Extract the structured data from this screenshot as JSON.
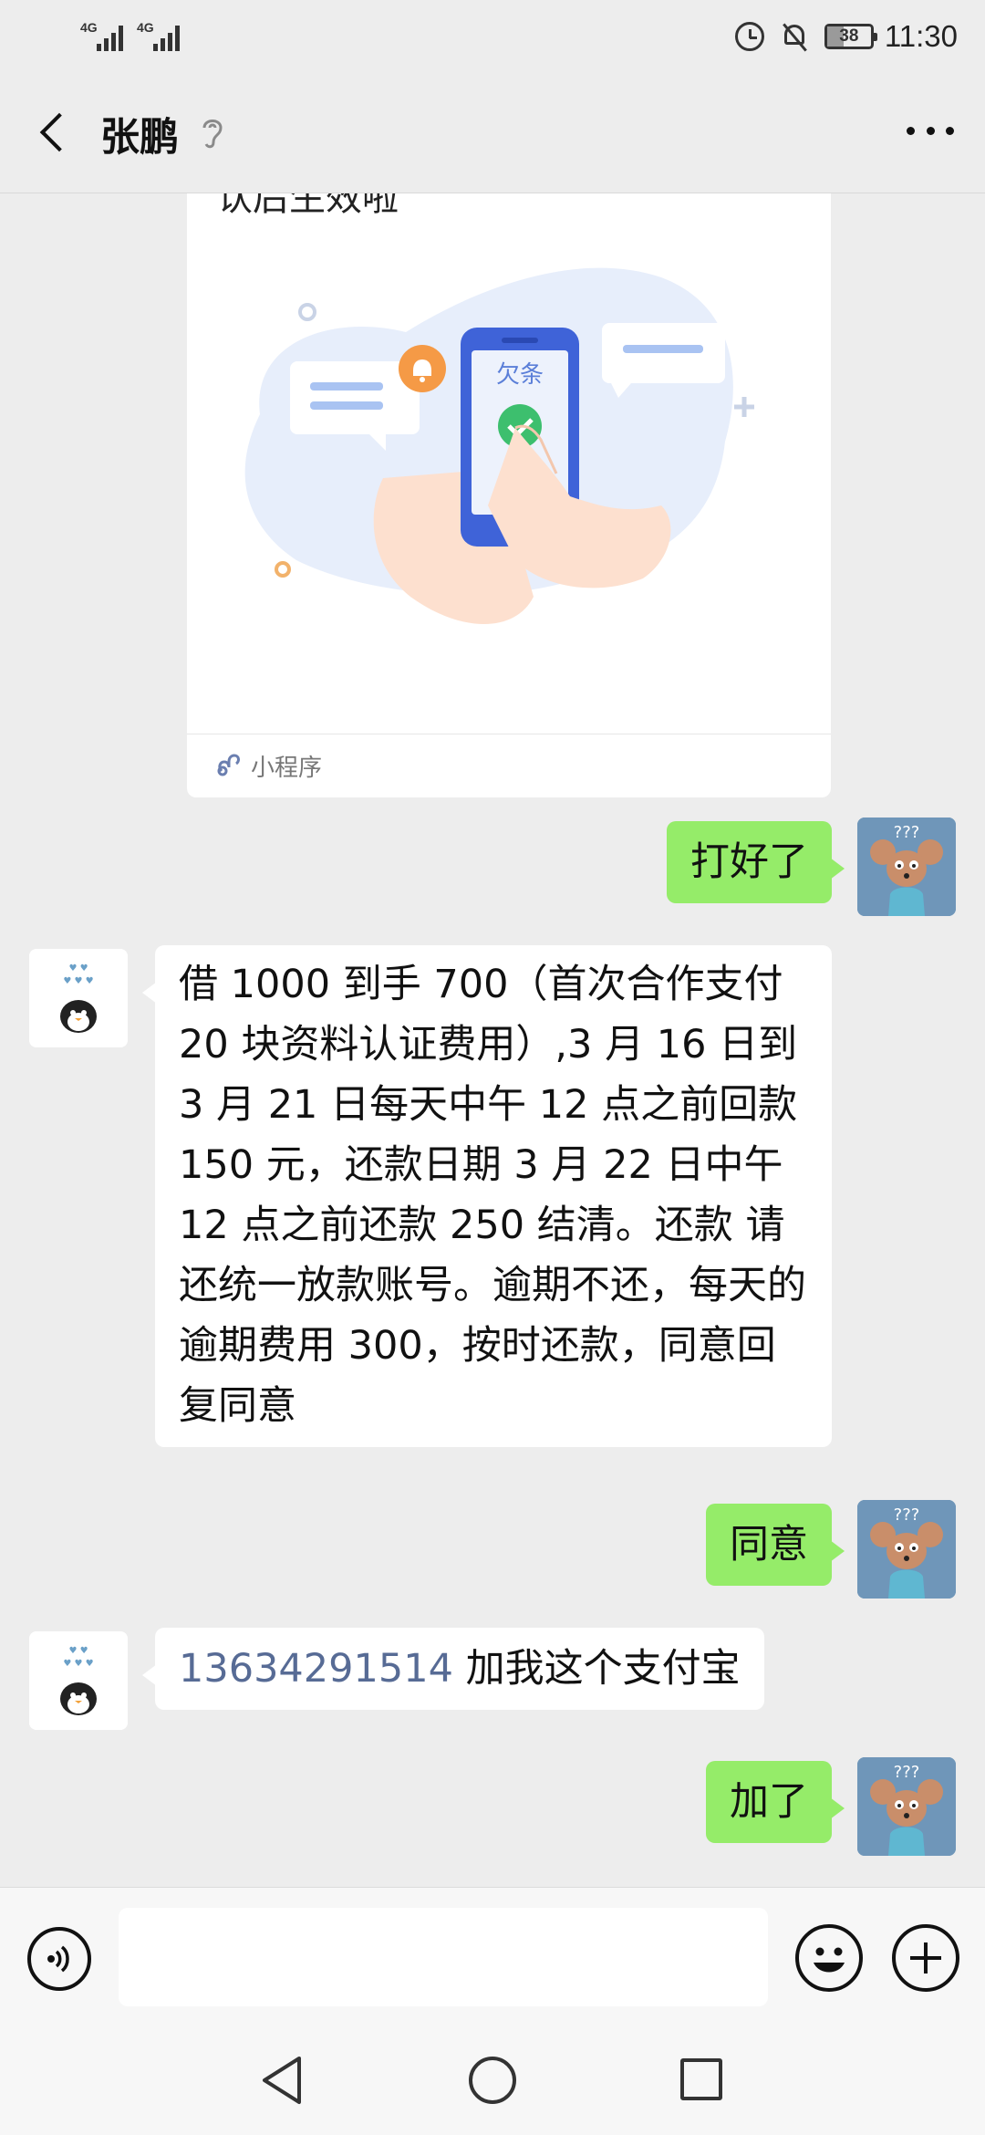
{
  "status_bar": {
    "sim1_label": "4G",
    "sim2_label": "4G",
    "battery_level": "38",
    "time": "11:30"
  },
  "header": {
    "title": "张鹏"
  },
  "mini_program_card": {
    "title_cut": "认后生效啦",
    "phone_screen_text": "欠条",
    "footer_label": "小程序"
  },
  "messages": {
    "m1": {
      "sender": "me",
      "text": "打好了"
    },
    "m2": {
      "sender": "other",
      "text": "借 1000 到手 700（首次合作支付 20 块资料认证费用）,3 月 16 日到 3 月 21 日每天中午 12 点之前回款 150 元，还款日期 3 月 22 日中午 12 点之前还款 250 结清。还款 请还统一放款账号。逾期不还，每天的逾期费用 300，按时还款，同意回复同意"
    },
    "m3": {
      "sender": "me",
      "text": "同意"
    },
    "m4": {
      "sender": "other",
      "phone": "13634291514",
      "text": " 加我这个支付宝"
    },
    "m5": {
      "sender": "me",
      "text": "加了"
    }
  },
  "input": {
    "value": "",
    "placeholder": ""
  },
  "colors": {
    "accent_green": "#95ec69",
    "link_blue": "#576b95",
    "background": "#ededed"
  },
  "icons": [
    "back-icon",
    "ear-icon",
    "more-icon",
    "voice-icon",
    "emoji-icon",
    "plus-icon",
    "nav-back-icon",
    "nav-home-icon",
    "nav-recent-icon"
  ]
}
